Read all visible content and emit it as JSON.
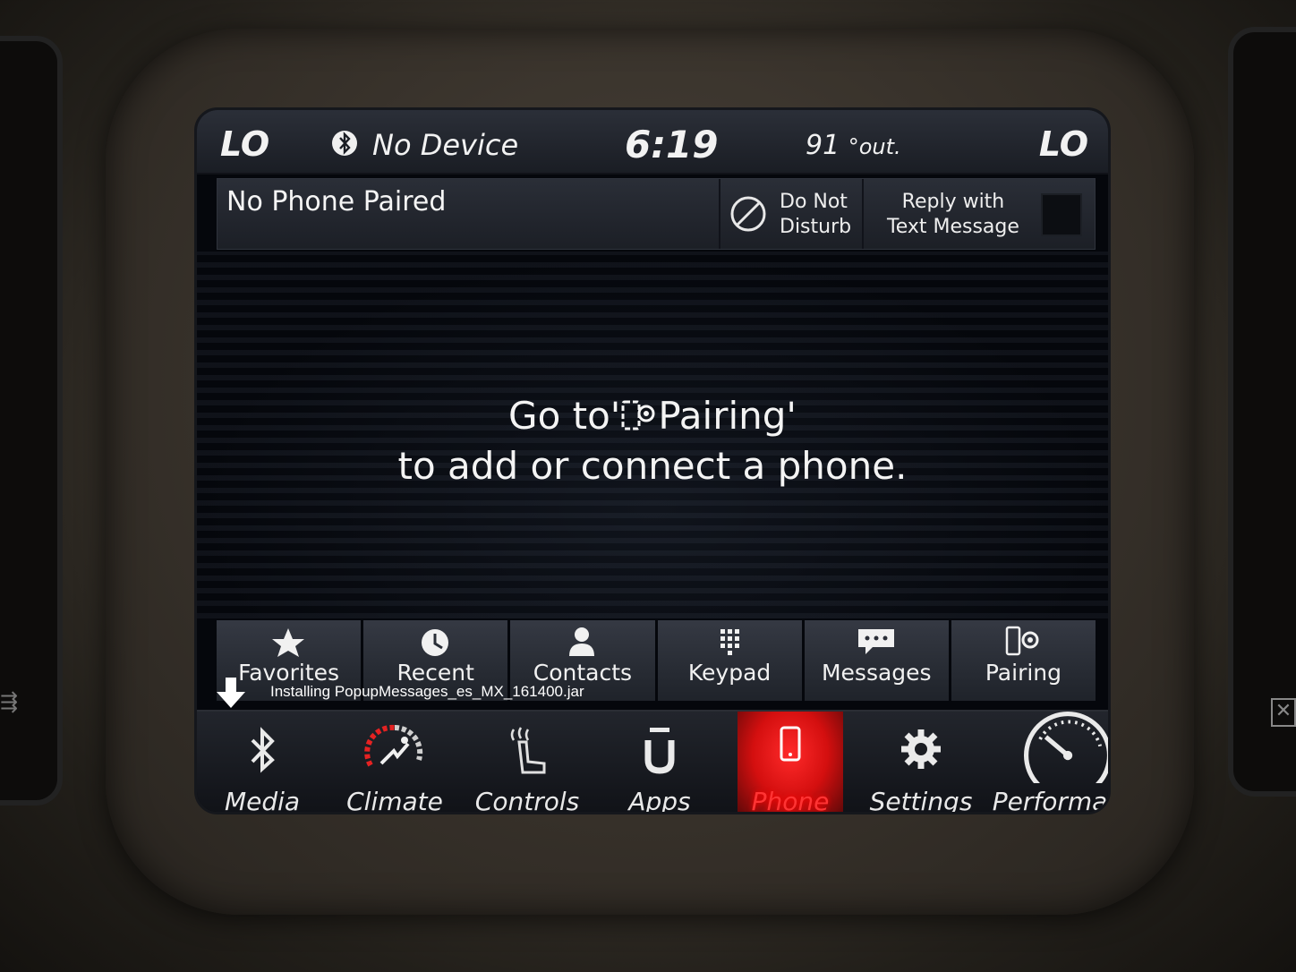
{
  "status": {
    "left_temp": "LO",
    "right_temp": "LO",
    "device": "No Device",
    "time": "6:19",
    "outside_temp": "91",
    "outside_unit": "°out."
  },
  "phone": {
    "title": "No Phone Paired",
    "dnd_line1": "Do Not",
    "dnd_line2": "Disturb",
    "reply_line1": "Reply with",
    "reply_line2": "Text Message"
  },
  "message": {
    "line1_prefix": "Go to'",
    "line1_suffix": "Pairing'",
    "line2": "to add or connect a phone."
  },
  "tabs": [
    {
      "label": "Favorites",
      "icon": "star-icon"
    },
    {
      "label": "Recent",
      "icon": "clock-icon"
    },
    {
      "label": "Contacts",
      "icon": "person-icon"
    },
    {
      "label": "Keypad",
      "icon": "keypad-icon"
    },
    {
      "label": "Messages",
      "icon": "speech-bubble-icon"
    },
    {
      "label": "Pairing",
      "icon": "phone-gear-icon"
    }
  ],
  "install_text": "Installing PopupMessages_es_MX_161400.jar",
  "nav": [
    {
      "label": "Media",
      "icon": "bluetooth-icon"
    },
    {
      "label": "Climate",
      "icon": "climate-icon"
    },
    {
      "label": "Controls",
      "icon": "seat-heat-icon"
    },
    {
      "label": "Apps",
      "icon": "apps-icon"
    },
    {
      "label": "Phone",
      "icon": "phone-icon"
    },
    {
      "label": "Settings",
      "icon": "gear-icon"
    },
    {
      "label": "Performa",
      "icon": "gauge-icon"
    }
  ],
  "colors": {
    "active": "#ff2020",
    "text": "#f2f2f2",
    "background": "#05070c"
  }
}
